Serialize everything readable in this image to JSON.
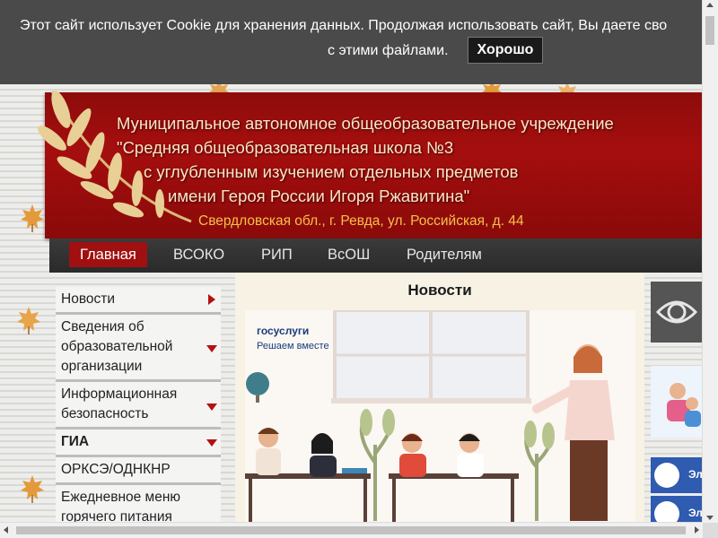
{
  "cookie": {
    "text_line1": "Этот сайт использует Cookie для хранения данных. Продолжая использовать сайт, Вы даете сво",
    "text_line2": "с этими файлами.",
    "accept_label": "Хорошо"
  },
  "header": {
    "title_lines": [
      "Муниципальное автономное общеобразовательное учреждение",
      "\"Средняя общеобразовательная школа №3",
      "с углубленным изучением отдельных предметов",
      "имени Героя России Игоря Ржавитина\""
    ],
    "address": "Свердловская обл., г. Ревда, ул. Российская, д. 44"
  },
  "nav": {
    "items": [
      {
        "label": "Главная",
        "active": true
      },
      {
        "label": "ВСОКО",
        "active": false
      },
      {
        "label": "РИП",
        "active": false
      },
      {
        "label": "ВсОШ",
        "active": false
      },
      {
        "label": "Родителям",
        "active": false
      }
    ]
  },
  "sidebar": {
    "items": [
      {
        "label": "Новости",
        "arrow": "right"
      },
      {
        "label": "Сведения об образовательной организации",
        "arrow": "down"
      },
      {
        "label": "Информационная безопасность",
        "arrow": "down"
      },
      {
        "label": "ГИА",
        "arrow": "down",
        "bold": true
      },
      {
        "label": "ОРКСЭ/ОДНКНР",
        "arrow": "none"
      },
      {
        "label": "Ежедневное меню горячего питания",
        "arrow": "none"
      }
    ]
  },
  "main": {
    "title": "Новости",
    "news_banner": {
      "logo": "госуслуги",
      "tagline": "Решаем вместе"
    }
  },
  "right": {
    "gos_label_1": "Эл",
    "gos_label_2": "Эл"
  },
  "colors": {
    "header_red": "#a50e0e",
    "nav_active": "#a01010",
    "title_text": "#fbe6c6",
    "address_text": "#f6c04a",
    "menu_arrow": "#b11212"
  }
}
